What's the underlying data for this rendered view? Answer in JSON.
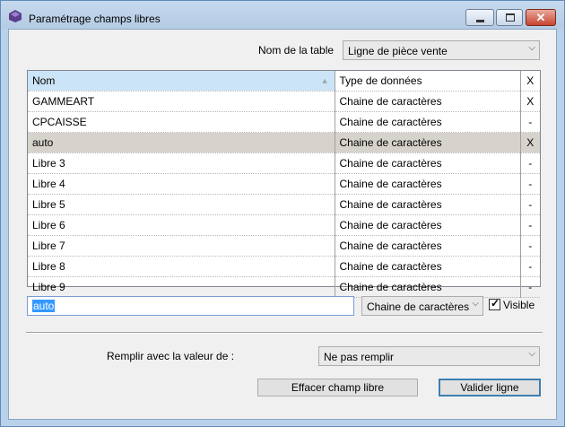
{
  "window": {
    "title": "Paramétrage champs libres"
  },
  "table_select": {
    "label": "Nom de la table",
    "value": "Ligne de pièce vente"
  },
  "grid": {
    "headers": {
      "name": "Nom",
      "type": "Type de données",
      "flag": "X"
    },
    "rows": [
      {
        "name": "GAMMEART",
        "type": "Chaine de caractères",
        "flag": "X",
        "selected": false
      },
      {
        "name": "CPCAISSE",
        "type": "Chaine de caractères",
        "flag": "-",
        "selected": false
      },
      {
        "name": "auto",
        "type": "Chaine de caractères",
        "flag": "X",
        "selected": true
      },
      {
        "name": "Libre 3",
        "type": "Chaine de caractères",
        "flag": "-",
        "selected": false
      },
      {
        "name": "Libre 4",
        "type": "Chaine de caractères",
        "flag": "-",
        "selected": false
      },
      {
        "name": "Libre 5",
        "type": "Chaine de caractères",
        "flag": "-",
        "selected": false
      },
      {
        "name": "Libre 6",
        "type": "Chaine de caractères",
        "flag": "-",
        "selected": false
      },
      {
        "name": "Libre 7",
        "type": "Chaine de caractères",
        "flag": "-",
        "selected": false
      },
      {
        "name": "Libre 8",
        "type": "Chaine de caractères",
        "flag": "-",
        "selected": false
      },
      {
        "name": "Libre 9",
        "type": "Chaine de caractères",
        "flag": "-",
        "selected": false
      }
    ]
  },
  "editor": {
    "name_value": "auto",
    "type_value": "Chaine de caractères",
    "visible_label": "Visible",
    "visible_checked": true
  },
  "fill": {
    "label": "Remplir avec la valeur de :",
    "value": "Ne pas remplir"
  },
  "buttons": {
    "clear": "Effacer champ libre",
    "validate": "Valider ligne"
  },
  "icons": {
    "app": "app-icon",
    "minimize": "minimize-icon",
    "maximize": "maximize-icon",
    "close": "close-icon",
    "sort": "sort-arrow-icon",
    "dropdown": "chevron-down-icon",
    "check": "checkmark-icon"
  },
  "colors": {
    "header_highlight": "#cce4f7",
    "selected_row": "#d6d2cc",
    "text_selection": "#3399ff",
    "close_button": "#c7452f"
  }
}
